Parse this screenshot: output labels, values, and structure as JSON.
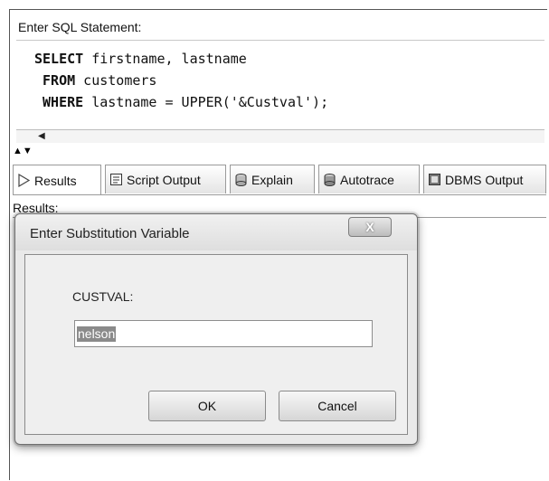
{
  "editor": {
    "label": "Enter SQL Statement:",
    "lines": [
      {
        "kw": "SELECT",
        "rest": " firstname, lastname"
      },
      {
        "kw": "FROM",
        "rest": " customers"
      },
      {
        "kw": "WHERE",
        "rest": " lastname = UPPER('&Custval');"
      }
    ]
  },
  "tabs": [
    {
      "label": "Results",
      "icon": "play-arrow-icon"
    },
    {
      "label": "Script Output",
      "icon": "script-output-icon"
    },
    {
      "label": "Explain",
      "icon": "explain-plan-icon"
    },
    {
      "label": "Autotrace",
      "icon": "autotrace-icon"
    },
    {
      "label": "DBMS Output",
      "icon": "dbms-output-icon"
    }
  ],
  "results": {
    "label": "Results:"
  },
  "dialog": {
    "title": "Enter Substitution Variable",
    "close_label": "X",
    "variable_label": "CUSTVAL:",
    "variable_value": "nelson",
    "ok_label": "OK",
    "cancel_label": "Cancel"
  }
}
